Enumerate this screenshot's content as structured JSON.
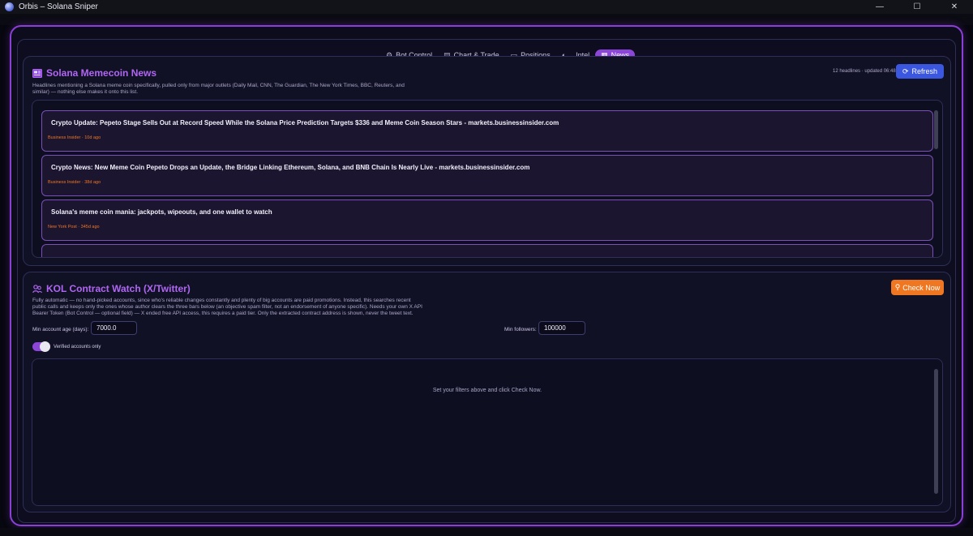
{
  "window": {
    "title": "Orbis – Solana Sniper"
  },
  "tabs": [
    {
      "label": "Bot Control",
      "icon": "⚙"
    },
    {
      "label": "Chart & Trade",
      "icon": "▤"
    },
    {
      "label": "Positions",
      "icon": "▭"
    },
    {
      "label": "Intel",
      "icon": "◐"
    },
    {
      "label": "News",
      "icon": "▦"
    }
  ],
  "news": {
    "title": "Solana Memecoin News",
    "description": "Headlines mentioning a Solana meme coin specifically, pulled only from major outlets (Daily Mail, CNN, The Guardian, The New York Times, BBC, Reuters, and similar) — nothing else makes it onto this list.",
    "meta": "12 headlines · updated 06:48",
    "refresh_label": "Refresh",
    "items": [
      {
        "headline": "Crypto Update: Pepeto Stage Sells Out at Record Speed While the Solana Price Prediction Targets $336 and Meme Coin Season Stars - markets.businessinsider.com",
        "source": "Business Insider · 10d ago"
      },
      {
        "headline": "Crypto News: New Meme Coin Pepeto Drops an Update, the Bridge Linking Ethereum, Solana, and BNB Chain Is Nearly Live - markets.businessinsider.com",
        "source": "Business Insider · 38d ago"
      },
      {
        "headline": "Solana's meme coin mania: jackpots, wipeouts, and one wallet to watch",
        "source": "New York Post · 345d ago"
      }
    ]
  },
  "kol": {
    "title": "KOL Contract Watch (X/Twitter)",
    "description": "Fully automatic — no hand-picked accounts, since who's reliable changes constantly and plenty of big accounts are paid promotions. Instead, this searches recent public calls and keeps only the ones whose author clears the three bars below (an objective spam filter, not an endorsement of anyone specific). Needs your own X API Bearer Token (Bot Control — optional field) — X ended free API access, this requires a paid tier. Only the extracted contract address is shown, never the tweet text.",
    "check_label": "Check Now",
    "min_age_label": "Min account age (days):",
    "min_age_value": "7000.0",
    "min_followers_label": "Min followers:",
    "min_followers_value": "100000",
    "verified_label": "Verified accounts only",
    "verified_on": true,
    "empty_text": "Set your filters above and click Check Now."
  },
  "colors": {
    "accent": "#8b46d8",
    "title": "#b066f2",
    "refresh": "#3b57e0",
    "check": "#f07722",
    "source": "#f07722"
  }
}
